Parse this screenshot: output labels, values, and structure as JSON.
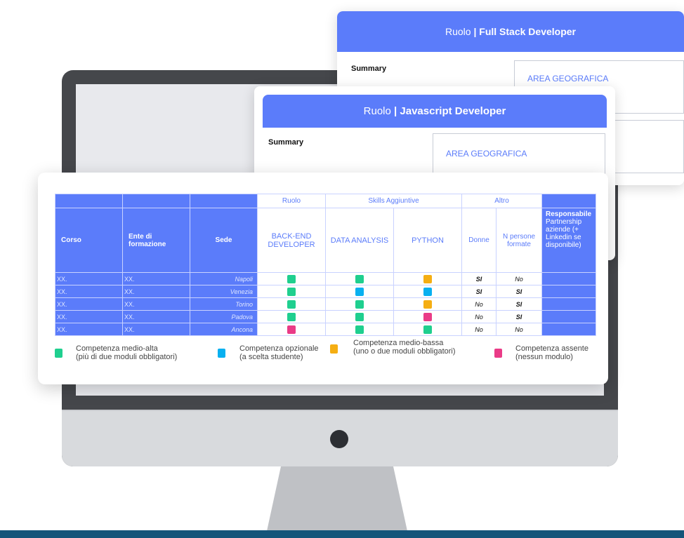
{
  "colors": {
    "header_blue": "#5b7cfa",
    "green": "#1fcf8f",
    "cyan": "#08b0f0",
    "orange": "#f5ae13",
    "pink": "#ea3b87",
    "footer": "#14557a"
  },
  "card_fullstack": {
    "role_label": "Ruolo",
    "separator": "|",
    "role_name": "Full Stack Developer",
    "summary": "Summary",
    "area": "AREA GEOGRAFICA"
  },
  "card_js": {
    "role_label": "Ruolo",
    "separator": "|",
    "role_name": "Javascript Developer",
    "summary": "Summary",
    "area": "AREA GEOGRAFICA"
  },
  "table": {
    "groups": {
      "ruolo": "Ruolo",
      "skills": "Skills Aggiuntive",
      "altro": "Altro"
    },
    "headers": {
      "corso": "Corso",
      "ente": "Ente di formazione",
      "sede": "Sede",
      "backend": "BACK-END DEVELOPER",
      "data": "DATA ANALYSIS",
      "python": "PYTHON",
      "donne": "Donne",
      "npersone": "N persone formate",
      "resp_bold": "Responsabile",
      "resp_rest": "Partnership aziende (+ Linkedin se disponibile)"
    },
    "rows": [
      {
        "corso": "XX.",
        "ente": "XX.",
        "sede": "Napoli",
        "backend": "green",
        "data": "green",
        "python": "orange",
        "donne": "SI",
        "npersone": "No"
      },
      {
        "corso": "XX.",
        "ente": "XX.",
        "sede": "Venezia",
        "backend": "green",
        "data": "cyan",
        "python": "cyan",
        "donne": "SI",
        "npersone": "SI"
      },
      {
        "corso": "XX.",
        "ente": "XX.",
        "sede": "Torino",
        "backend": "green",
        "data": "green",
        "python": "orange",
        "donne": "No",
        "npersone": "SI"
      },
      {
        "corso": "XX.",
        "ente": "XX.",
        "sede": "Padova",
        "backend": "green",
        "data": "green",
        "python": "pink",
        "donne": "No",
        "npersone": "SI"
      },
      {
        "corso": "XX.",
        "ente": "XX.",
        "sede": "Ancona",
        "backend": "pink",
        "data": "green",
        "python": "green",
        "donne": "No",
        "npersone": "No"
      }
    ]
  },
  "legend": [
    {
      "color": "green",
      "line1": "Competenza medio-alta",
      "line2": "(più di due moduli obbligatori)"
    },
    {
      "color": "cyan",
      "line1": "Competenza opzionale",
      "line2": "(a scelta studente)"
    },
    {
      "color": "orange",
      "line1": "Competenza medio-bassa",
      "line2": "(uno o due moduli obbligatori)"
    },
    {
      "color": "pink",
      "line1": "Competenza assente",
      "line2": "(nessun modulo)"
    }
  ]
}
